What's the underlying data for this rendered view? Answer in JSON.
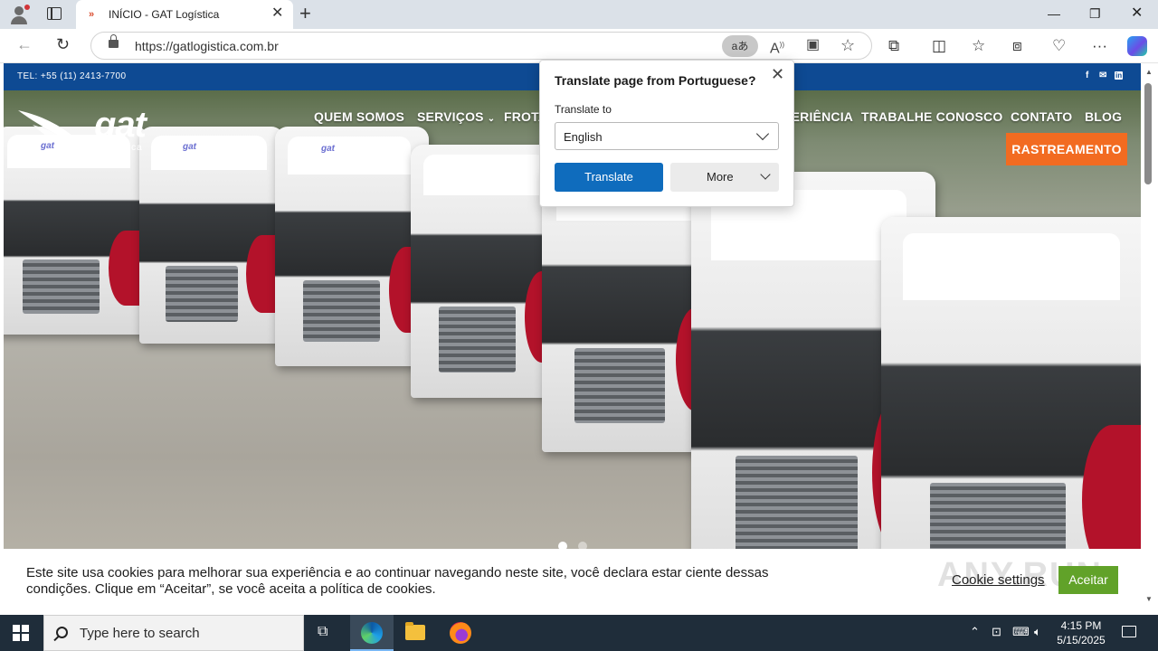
{
  "browser": {
    "tab_title": "INÍCIO - GAT Logística",
    "tab_favicon": "»",
    "url": "https://gatlogistica.com.br",
    "translate_pill": "aあ"
  },
  "site": {
    "phone": "TEL: +55 (11) 2413-7700",
    "logo_text": "gat",
    "logo_sub": "logística",
    "truck_brand": "gat",
    "menu": [
      "QUEM SOMOS",
      "SERVIÇOS",
      "FROTA",
      "EXPERIÊNCIA",
      "TRABALHE CONOSCO",
      "CONTATO",
      "BLOG"
    ],
    "cta": "RASTREAMENTO",
    "social_icons": [
      "facebook-icon",
      "email-icon",
      "linkedin-icon"
    ]
  },
  "translate_popup": {
    "title": "Translate page from Portuguese?",
    "label": "Translate to",
    "selected_language": "English",
    "translate_button": "Translate",
    "more_button": "More"
  },
  "cookie": {
    "text": "Este site usa cookies para melhorar sua experiência e ao continuar navegando neste site, você declara estar ciente dessas condições. Clique em “Aceitar”, se você aceita a política de cookies.",
    "settings": "Cookie settings",
    "accept": "Aceitar",
    "watermark": "ANY.RUN"
  },
  "taskbar": {
    "search_placeholder": "Type here to search",
    "time": "4:15 PM",
    "date": "5/15/2025"
  },
  "colors": {
    "topbar": "#0e4a93",
    "cta": "#f26b21",
    "accept": "#61a229",
    "translate_button": "#0f6cbd"
  }
}
